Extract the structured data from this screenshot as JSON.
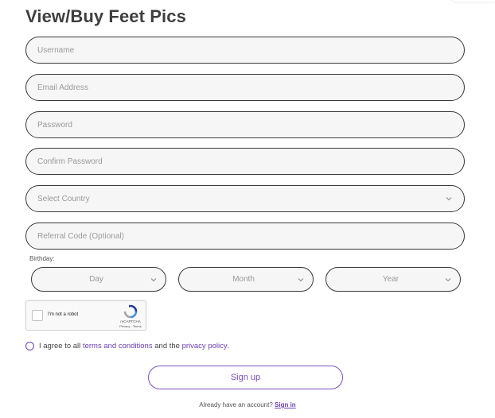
{
  "page": {
    "title": "View/Buy Feet Pics"
  },
  "form": {
    "username_placeholder": "Username",
    "email_placeholder": "Email Address",
    "password_placeholder": "Password",
    "confirm_password_placeholder": "Confirm Password",
    "country_placeholder": "Select Country",
    "referral_placeholder": "Referral Code (Optional)",
    "birthday_label": "Birthday:",
    "day_placeholder": "Day",
    "month_placeholder": "Month",
    "year_placeholder": "Year"
  },
  "captcha": {
    "label": "I'm not a robot",
    "brand": "reCAPTCHA",
    "links": "Privacy - Terms"
  },
  "agreement": {
    "prefix": "I agree to all",
    "terms_link": "terms and conditions",
    "middle": "and the",
    "privacy_link": "privacy policy",
    "suffix": "."
  },
  "actions": {
    "signup_label": "Sign up",
    "signin_prompt": "Already have an account?",
    "signin_link": "Sign in"
  },
  "colors": {
    "accent": "#7b4fbf",
    "border": "#3a3a3a",
    "field_bg": "#f6f6f6",
    "title": "#3f3f3f"
  },
  "icons": {
    "select_chevron": "chevron-down-icon",
    "captcha_logo": "recaptcha-logo-icon"
  }
}
